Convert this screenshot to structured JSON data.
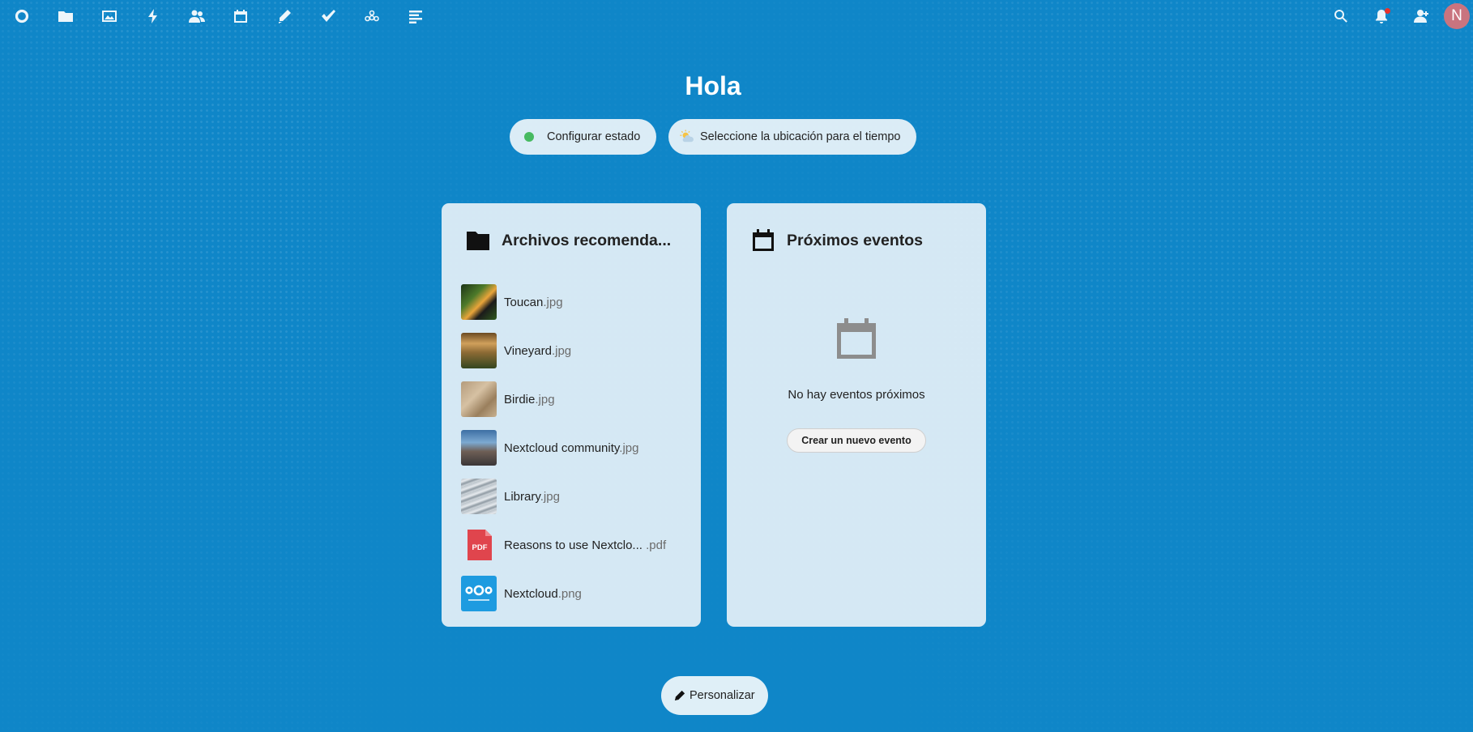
{
  "header": {
    "avatar_initial": "N",
    "apps": [
      {
        "icon": "nextcloud-logo-icon"
      },
      {
        "icon": "files-icon"
      },
      {
        "icon": "photos-icon"
      },
      {
        "icon": "activity-icon"
      },
      {
        "icon": "contacts-icon"
      },
      {
        "icon": "calendar-icon"
      },
      {
        "icon": "notes-icon"
      },
      {
        "icon": "tasks-icon"
      },
      {
        "icon": "circles-icon"
      },
      {
        "icon": "deck-icon"
      }
    ]
  },
  "greeting": "Hola",
  "status": {
    "set_status_label": "Configurar estado",
    "weather_label": "Seleccione la ubicación para el tiempo",
    "status_color": "#46ba61"
  },
  "files_panel": {
    "title": "Archivos recomenda...",
    "files": [
      {
        "name": "Toucan",
        "ext": ".jpg"
      },
      {
        "name": "Vineyard",
        "ext": ".jpg"
      },
      {
        "name": "Birdie",
        "ext": ".jpg"
      },
      {
        "name": "Nextcloud community",
        "ext": ".jpg"
      },
      {
        "name": "Library",
        "ext": ".jpg"
      },
      {
        "name": "Reasons to use Nextclo... ",
        "ext": ".pdf"
      },
      {
        "name": "Nextcloud",
        "ext": ".png"
      }
    ],
    "pdf_badge": "PDF"
  },
  "events_panel": {
    "title": "Próximos eventos",
    "empty_text": "No hay eventos próximos",
    "create_button": "Crear un nuevo evento"
  },
  "customize_button": "Personalizar",
  "colors": {
    "background": "#0f86c8",
    "avatar": "#c9747f",
    "notification_dot": "#e9322d",
    "pdf_red": "#e0454d"
  }
}
